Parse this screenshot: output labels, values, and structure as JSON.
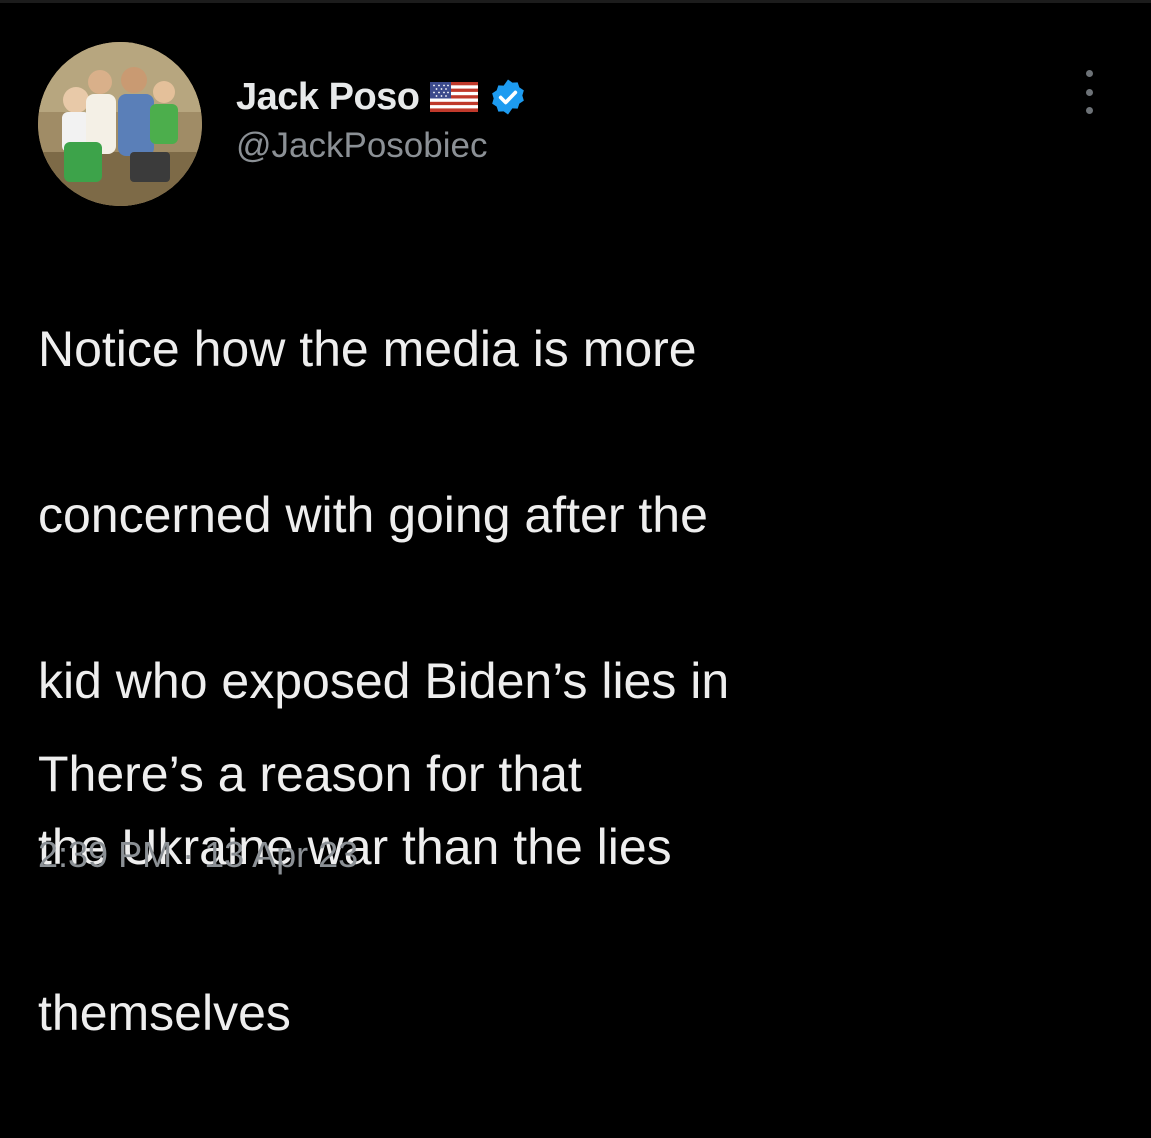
{
  "tweet": {
    "author": {
      "display_name": "Jack Poso",
      "flag_icon": "us-flag-icon",
      "verified_icon": "verified-badge-icon",
      "handle": "@JackPosobiec",
      "avatar_icon": "profile-photo"
    },
    "more_icon": "more-options-icon",
    "body_lines": [
      "Notice how the media is more",
      "concerned with going after the",
      "kid who exposed Biden’s lies in",
      "the Ukraine war than the lies",
      "themselves"
    ],
    "body_second": "There’s a reason for that",
    "time": "2:39 PM",
    "separator": " · ",
    "date": "13 Apr 23"
  },
  "colors": {
    "background": "#000000",
    "primary_text": "#e7e9ea",
    "secondary_text": "#8b9095",
    "verified_blue": "#1d9bf0"
  }
}
